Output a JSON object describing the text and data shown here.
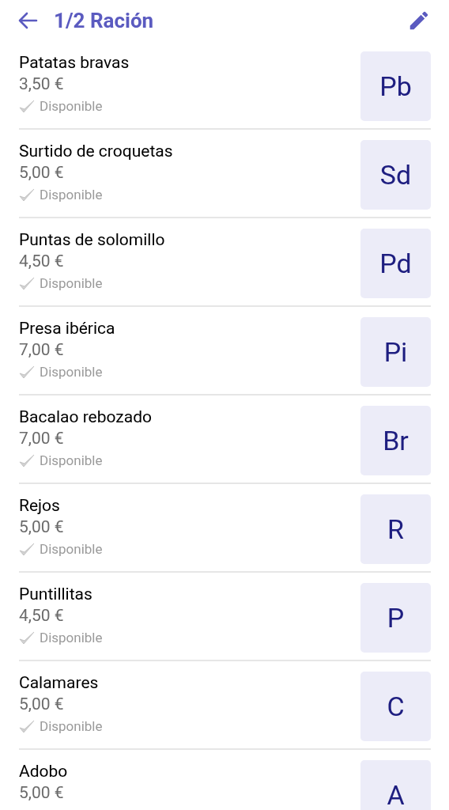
{
  "header": {
    "title": "1/2 Ración"
  },
  "items": [
    {
      "name": "Patatas bravas",
      "price": "3,50 €",
      "status": "Disponible",
      "initials": "Pb"
    },
    {
      "name": "Surtido de croquetas",
      "price": "5,00 €",
      "status": "Disponible",
      "initials": "Sd"
    },
    {
      "name": "Puntas de solomillo",
      "price": "4,50 €",
      "status": "Disponible",
      "initials": "Pd"
    },
    {
      "name": "Presa ibérica",
      "price": "7,00 €",
      "status": "Disponible",
      "initials": "Pi"
    },
    {
      "name": "Bacalao rebozado",
      "price": "7,00 €",
      "status": "Disponible",
      "initials": "Br"
    },
    {
      "name": "Rejos",
      "price": "5,00 €",
      "status": "Disponible",
      "initials": "R"
    },
    {
      "name": "Puntillitas",
      "price": "4,50 €",
      "status": "Disponible",
      "initials": "P"
    },
    {
      "name": "Calamares",
      "price": "5,00 €",
      "status": "Disponible",
      "initials": "C"
    },
    {
      "name": "Adobo",
      "price": "5,00 €",
      "initials": "A"
    }
  ]
}
